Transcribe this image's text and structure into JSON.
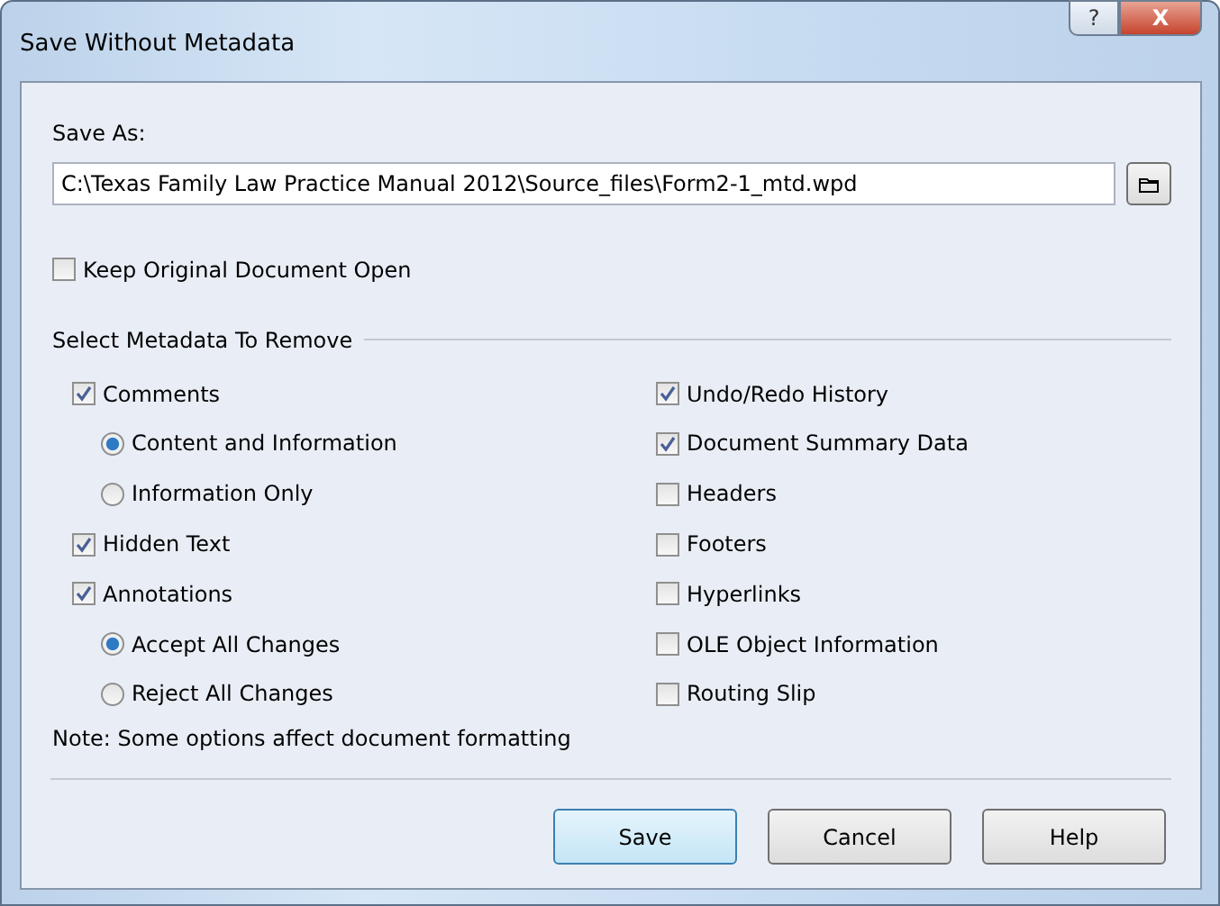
{
  "window": {
    "title": "Save Without Metadata",
    "controls": [
      "?",
      "X"
    ]
  },
  "save_as": {
    "label": "Save As:",
    "value": "C:\\Texas Family Law Practice Manual 2012\\Source_files\\Form2-1_mtd.wpd"
  },
  "keep_open": {
    "label": "Keep Original Document Open",
    "checked": false
  },
  "metadata": {
    "title": "Select Metadata To Remove",
    "left": [
      {
        "label": "Comments",
        "checked": true,
        "children": [
          {
            "label": "Content and Information",
            "selected": true
          },
          {
            "label": "Information Only",
            "selected": false
          }
        ]
      },
      {
        "label": "Hidden Text",
        "checked": true
      },
      {
        "label": "Annotations",
        "checked": true,
        "children": [
          {
            "label": "Accept All Changes",
            "selected": true
          },
          {
            "label": "Reject All Changes",
            "selected": false
          }
        ]
      }
    ],
    "right": [
      {
        "label": "Undo/Redo History",
        "checked": true
      },
      {
        "label": "Document Summary Data",
        "checked": true
      },
      {
        "label": "Headers",
        "checked": false
      },
      {
        "label": "Footers",
        "checked": false
      },
      {
        "label": "Hyperlinks",
        "checked": false
      },
      {
        "label": "OLE Object Information",
        "checked": false
      },
      {
        "label": "Routing Slip",
        "checked": false
      }
    ]
  },
  "note": "Note: Some options affect document formatting",
  "buttons": [
    {
      "label": "Save",
      "default": true
    },
    {
      "label": "Cancel",
      "default": false
    },
    {
      "label": "Help",
      "default": false
    }
  ]
}
